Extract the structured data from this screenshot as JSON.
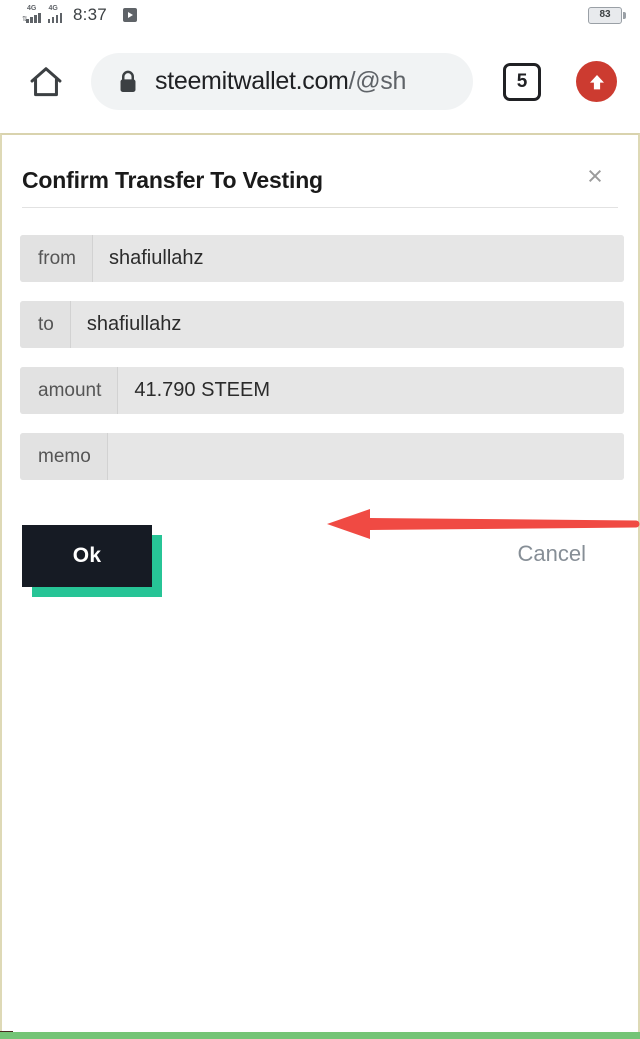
{
  "status_bar": {
    "signal_1_label": "4G",
    "signal_2_label": "4G",
    "time": "8:37",
    "play_icon": "play-badge-icon",
    "battery_percent": "83"
  },
  "browser": {
    "home_icon": "home-icon",
    "lock_icon": "lock-icon",
    "url_host": "steemitwallet.com",
    "url_path": "/@sh",
    "tab_count": "5",
    "update_icon": "up-arrow-circle-icon"
  },
  "dialog": {
    "title": "Confirm Transfer To Vesting",
    "close_icon": "close-icon",
    "close_glyph": "×",
    "fields": [
      {
        "label": "from",
        "value": "shafiullahz"
      },
      {
        "label": "to",
        "value": "shafiullahz"
      },
      {
        "label": "amount",
        "value": "41.790 STEEM"
      },
      {
        "label": "memo",
        "value": ""
      }
    ],
    "ok_label": "Ok",
    "cancel_label": "Cancel"
  },
  "annotation": {
    "arrow_icon": "red-left-arrow-icon",
    "arrow_color": "#f04a43",
    "points_at": "amount"
  },
  "colors": {
    "accent_teal": "#27c496",
    "ok_button_bg": "#161b24",
    "cancel_text": "#868e96",
    "field_bg": "#e6e6e6",
    "field_label_bg": "#e2e2e2",
    "page_border": "#ded9b6",
    "update_red": "#cc3b30",
    "bottom_bar_green": "#74c476"
  }
}
